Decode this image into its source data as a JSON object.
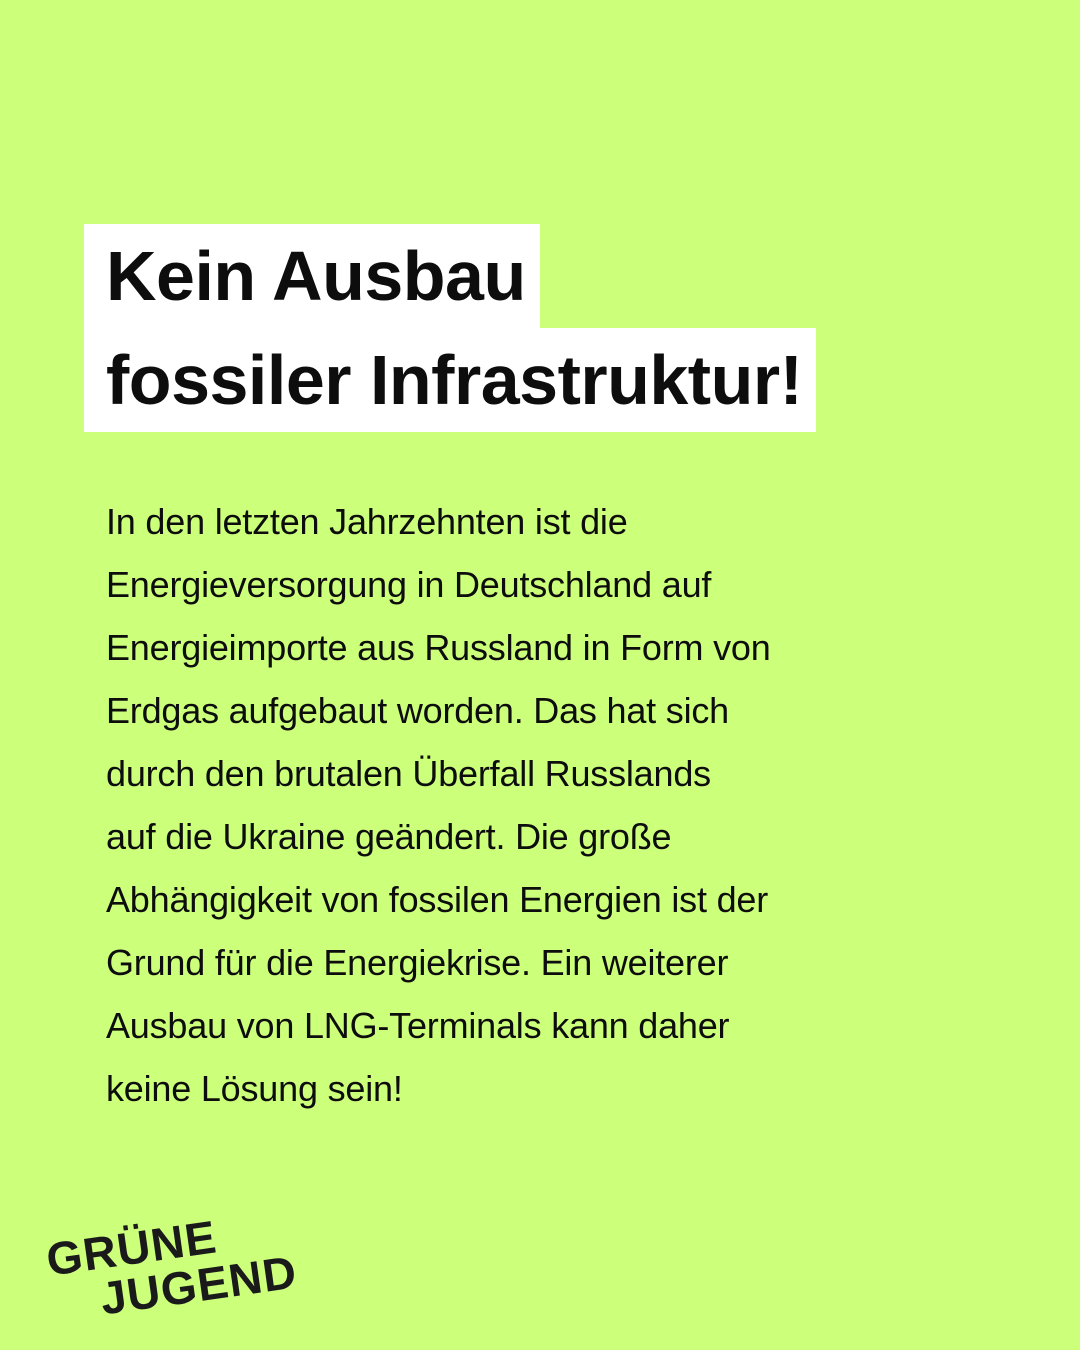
{
  "headline": {
    "line1": "Kein Ausbau",
    "line2": "fossiler Infrastruktur!"
  },
  "body": {
    "lines": [
      "In den letzten Jahrzehnten ist die",
      "Energieversorgung in Deutschland auf",
      "Energieimporte aus Russland in Form von",
      "Erdgas aufgebaut worden. Das hat sich",
      "durch den brutalen Überfall Russlands",
      "auf die Ukraine geändert. Die große",
      "Abhängigkeit von fossilen Energien ist der",
      "Grund für die Energiekrise. Ein weiterer",
      "Ausbau von LNG-Terminals kann daher",
      "keine Lösung sein!"
    ]
  },
  "logo": {
    "line1": "GRÜNE",
    "line2": "JUGEND"
  },
  "colors": {
    "background": "#ccff7a",
    "headline_box": "#ffffff",
    "text": "#0d0d0d"
  }
}
